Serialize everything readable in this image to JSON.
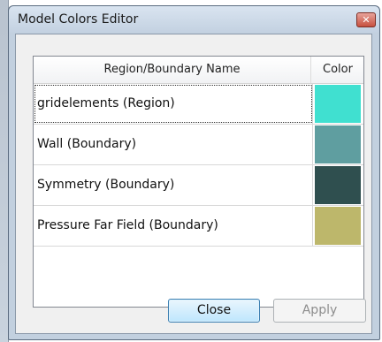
{
  "window": {
    "title": "Model Colors Editor",
    "close_glyph": "✕"
  },
  "table": {
    "columns": [
      "Region/Boundary Name",
      "Color"
    ],
    "rows": [
      {
        "name": "gridelements (Region)",
        "color": "#40e0d0"
      },
      {
        "name": "Wall (Boundary)",
        "color": "#5f9ea0"
      },
      {
        "name": "Symmetry (Boundary)",
        "color": "#2f4f4f"
      },
      {
        "name": "Pressure Far Field (Boundary)",
        "color": "#bdb76b"
      }
    ]
  },
  "buttons": {
    "close": "Close",
    "apply": "Apply"
  }
}
